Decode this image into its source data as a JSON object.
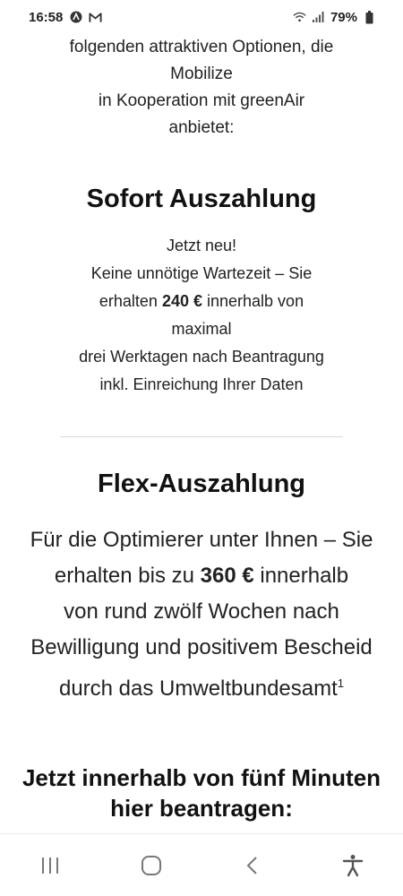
{
  "status": {
    "time": "16:58",
    "battery": "79%",
    "icons": [
      "app-icon",
      "gmail-icon",
      "wifi-icon",
      "signal-icon",
      "battery-icon"
    ]
  },
  "intro": {
    "line1": "folgenden attraktiven Optionen, die",
    "line2": "Mobilize",
    "line3": "in Kooperation mit greenAir",
    "line4": "anbietet:"
  },
  "sofort": {
    "title": "Sofort Auszahlung",
    "line1": "Jetzt neu!",
    "line2": "Keine unnötige Wartezeit – Sie",
    "line3_pre": "erhalten ",
    "amount": "240 €",
    "line3_post": " innerhalb von",
    "line4": "maximal",
    "line5": "drei Werktagen nach Beantragung",
    "line6": "inkl. Einreichung Ihrer Daten"
  },
  "flex": {
    "title": "Flex-Auszahlung",
    "line1": "Für die Optimierer unter Ihnen – Sie",
    "line2_pre": "erhalten bis zu ",
    "amount": "360 €",
    "line2_post": " innerhalb",
    "line3": "von rund zwölf Wochen nach",
    "line4": "Bewilligung und positivem Bescheid",
    "line5": "durch das Umweltbundesamt",
    "footnote": "1"
  },
  "cta": {
    "line1": "Jetzt innerhalb von fünf Minuten",
    "line2": "hier beantragen:"
  },
  "navbar": {
    "icons": [
      "recent-apps-icon",
      "home-icon",
      "back-icon",
      "accessibility-icon"
    ]
  }
}
